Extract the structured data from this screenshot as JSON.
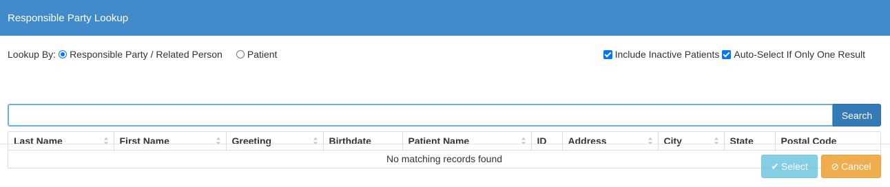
{
  "header": {
    "title": "Responsible Party Lookup"
  },
  "lookup": {
    "label": "Lookup By:",
    "options": [
      {
        "label": "Responsible Party / Related Person",
        "checked": true
      },
      {
        "label": "Patient",
        "checked": false
      }
    ]
  },
  "toggles": {
    "include_inactive": {
      "label": "Include Inactive Patients",
      "checked": true
    },
    "auto_select": {
      "label": "Auto-Select If Only One Result",
      "checked": true
    }
  },
  "search": {
    "value": "",
    "placeholder": "",
    "button_label": "Search"
  },
  "table": {
    "columns": [
      "Last Name",
      "First Name",
      "Greeting",
      "Birthdate",
      "Patient Name",
      "ID",
      "Address",
      "City",
      "State",
      "Postal Code"
    ],
    "empty_message": "No matching records found"
  },
  "footer": {
    "select_label": "Select",
    "cancel_label": "Cancel"
  },
  "colors": {
    "header_bg": "#428bca",
    "primary": "#337ab7",
    "info": "#5bc0de",
    "warning": "#f0ad4e"
  },
  "icons": {
    "select": "check-icon",
    "cancel": "ban-icon"
  }
}
